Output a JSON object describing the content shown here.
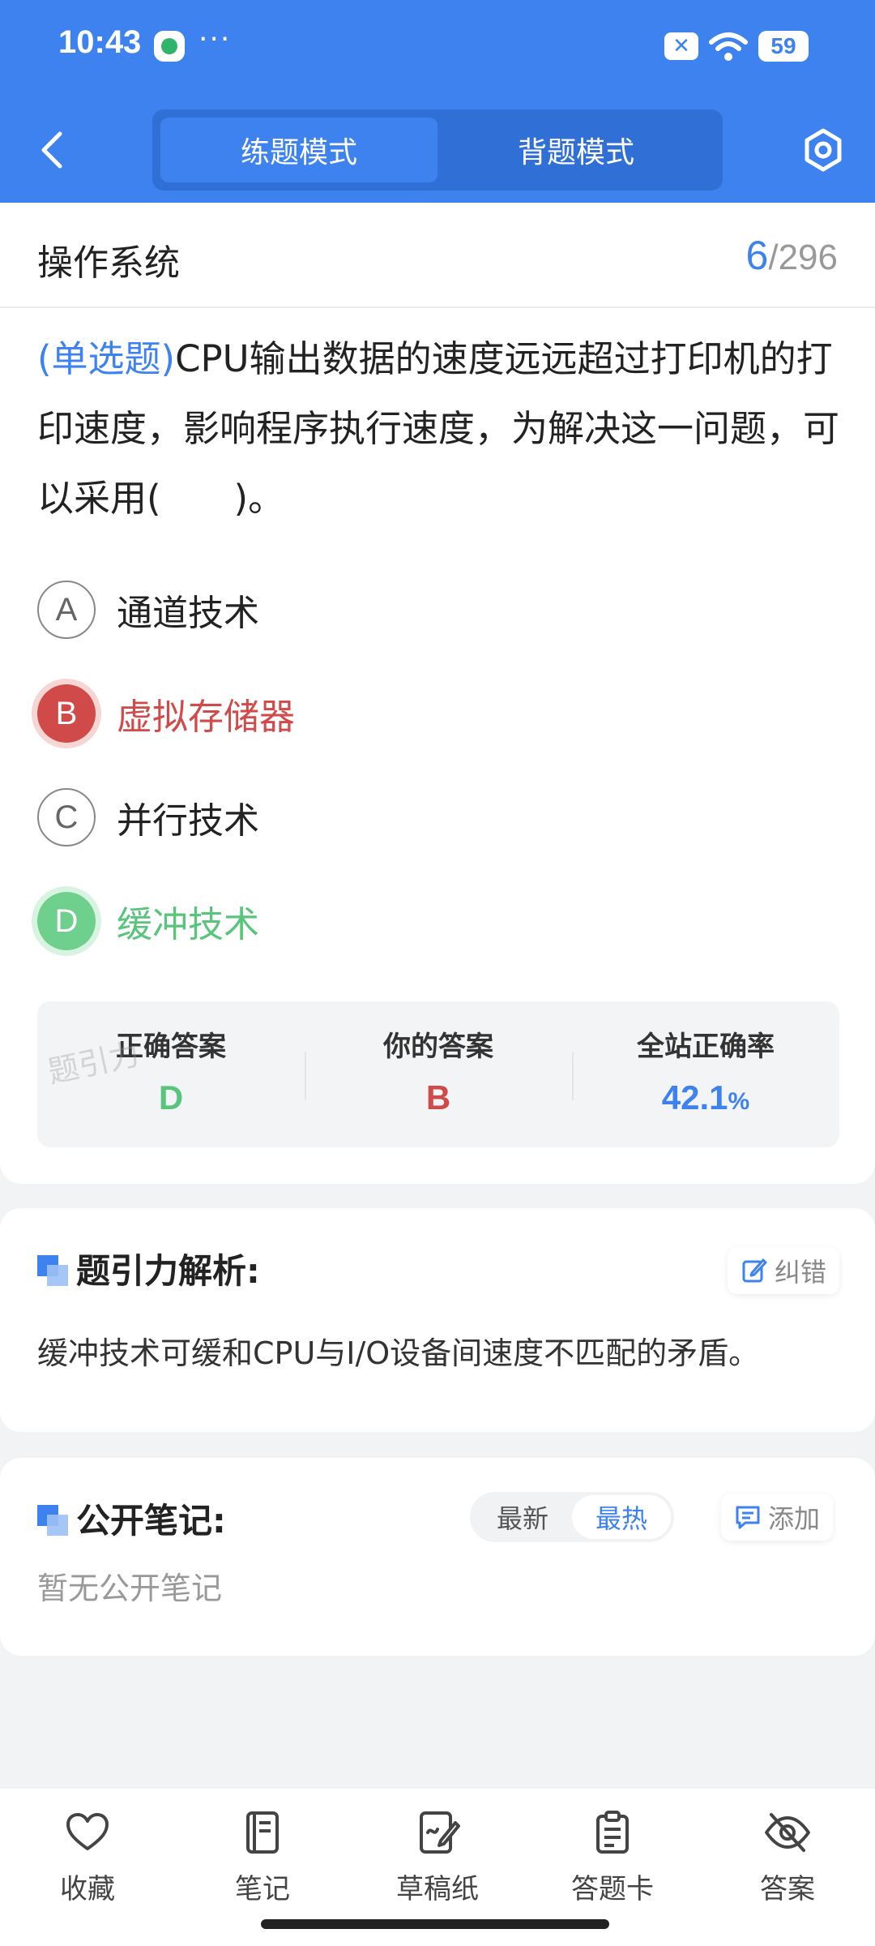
{
  "status": {
    "time": "10:43",
    "dots": "···",
    "battery": "59"
  },
  "header": {
    "modes": [
      "练题模式",
      "背题模式"
    ],
    "active_mode": "练题模式"
  },
  "subject": {
    "title": "操作系统",
    "current": "6",
    "separator": "/",
    "total": "296"
  },
  "question": {
    "type": "(单选题)",
    "text": "CPU输出数据的速度远远超过打印机的打印速度，影响程序执行速度，为解决这一问题，可以采用(　　)。",
    "options": [
      {
        "letter": "A",
        "text": "通道技术",
        "state": "normal"
      },
      {
        "letter": "B",
        "text": "虚拟存储器",
        "state": "wrong"
      },
      {
        "letter": "C",
        "text": "并行技术",
        "state": "normal"
      },
      {
        "letter": "D",
        "text": "缓冲技术",
        "state": "correct"
      }
    ]
  },
  "answers": {
    "correct_label": "正确答案",
    "correct_value": "D",
    "yours_label": "你的答案",
    "yours_value": "B",
    "rate_label": "全站正确率",
    "rate_value": "42.1",
    "rate_unit": "%",
    "watermark": "题引力"
  },
  "analysis": {
    "title": "题引力解析:",
    "report_label": "纠错",
    "body": "缓冲技术可缓和CPU与I/O设备间速度不匹配的矛盾。"
  },
  "notes": {
    "title": "公开笔记:",
    "sort_options": [
      "最新",
      "最热"
    ],
    "active_sort": "最热",
    "add_label": "添加",
    "empty": "暂无公开笔记"
  },
  "bottom_nav": [
    "收藏",
    "笔记",
    "草稿纸",
    "答题卡",
    "答案"
  ],
  "colors": {
    "primary": "#3d82ee",
    "wrong": "#d04a4a",
    "correct": "#58c47c"
  }
}
